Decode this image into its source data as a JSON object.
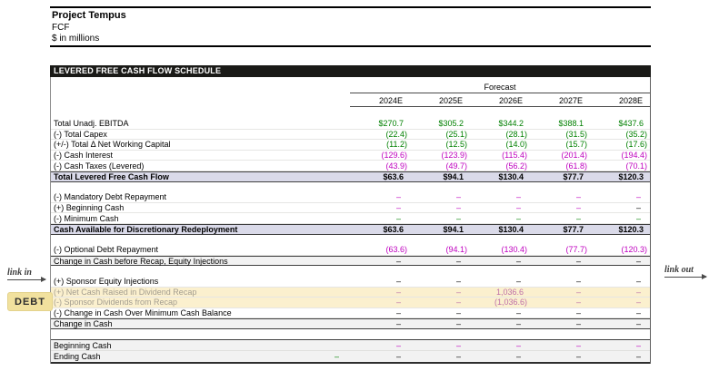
{
  "page_header": {
    "title": "Project Tempus",
    "subtitle": "FCF",
    "units": "$ in millions"
  },
  "section_bar": {
    "title": "LEVERED FREE CASH FLOW SCHEDULE"
  },
  "annotations": {
    "link_in": "link in",
    "link_out": "link out",
    "debt_button": "DEBT"
  },
  "colors": {
    "green": "#008000",
    "magenta": "#bf00bf",
    "black": "#000000",
    "mauve": "#be6fa8",
    "gray_label": "#a39d8f",
    "lavender_bg": "#dadae9",
    "yellow_bg": "#fbf0ce",
    "gray_bg": "#f2f2f2",
    "debt_button_bg": "#f1e19e",
    "section_bar_bg": "#1a1a17"
  },
  "table": {
    "header": {
      "group_label": "Forecast",
      "columns": [
        "2024E",
        "2025E",
        "2026E",
        "2027E",
        "2028E"
      ]
    },
    "rows": [
      {
        "label": "Total Unadj. EBITDA",
        "values": [
          "$270.7",
          "$305.2",
          "$344.2",
          "$388.1",
          "$437.6"
        ],
        "value_colors": [
          "green",
          "green",
          "green",
          "green",
          "green"
        ],
        "style": "normal"
      },
      {
        "label": "(-) Total Capex",
        "values": [
          "(22.4)",
          "(25.1)",
          "(28.1)",
          "(31.5)",
          "(35.2)"
        ],
        "value_colors": [
          "green",
          "green",
          "green",
          "green",
          "green"
        ],
        "style": "normal"
      },
      {
        "label": "(+/-) Total Δ Net Working Capital",
        "values": [
          "(11.2)",
          "(12.5)",
          "(14.0)",
          "(15.7)",
          "(17.6)"
        ],
        "value_colors": [
          "green",
          "green",
          "green",
          "green",
          "green"
        ],
        "style": "normal"
      },
      {
        "label": "(-) Cash Interest",
        "values": [
          "(129.6)",
          "(123.9)",
          "(115.4)",
          "(201.4)",
          "(194.4)"
        ],
        "value_colors": [
          "magenta",
          "magenta",
          "magenta",
          "magenta",
          "magenta"
        ],
        "style": "normal"
      },
      {
        "label": "(-) Cash Taxes (Levered)",
        "values": [
          "(43.9)",
          "(49.7)",
          "(56.2)",
          "(61.8)",
          "(70.1)"
        ],
        "value_colors": [
          "magenta",
          "magenta",
          "magenta",
          "magenta",
          "magenta"
        ],
        "style": "normal"
      },
      {
        "label": "Total Levered Free Cash Flow",
        "values": [
          "$63.6",
          "$94.1",
          "$130.4",
          "$77.7",
          "$120.3"
        ],
        "value_colors": [
          "black",
          "black",
          "black",
          "black",
          "black"
        ],
        "style": "total"
      },
      {
        "type": "spacer"
      },
      {
        "label": "(-) Mandatory Debt Repayment",
        "values": [
          "–",
          "–",
          "–",
          "–",
          "–"
        ],
        "value_colors": [
          "magenta",
          "magenta",
          "magenta",
          "magenta",
          "magenta"
        ],
        "style": "normal"
      },
      {
        "label": "(+) Beginning Cash",
        "values": [
          "–",
          "–",
          "–",
          "–",
          "–"
        ],
        "value_colors": [
          "magenta",
          "magenta",
          "magenta",
          "magenta",
          "black"
        ],
        "style": "normal"
      },
      {
        "label": "(-) Minimum Cash",
        "values": [
          "–",
          "–",
          "–",
          "–",
          "–"
        ],
        "value_colors": [
          "green",
          "green",
          "green",
          "green",
          "green"
        ],
        "style": "normal"
      },
      {
        "label": "Cash Available for Discretionary Redeployment",
        "values": [
          "$63.6",
          "$94.1",
          "$130.4",
          "$77.7",
          "$120.3"
        ],
        "value_colors": [
          "black",
          "black",
          "black",
          "black",
          "black"
        ],
        "style": "total"
      },
      {
        "type": "spacer"
      },
      {
        "label": "(-) Optional Debt Repayment",
        "values": [
          "(63.6)",
          "(94.1)",
          "(130.4)",
          "(77.7)",
          "(120.3)"
        ],
        "value_colors": [
          "magenta",
          "magenta",
          "magenta",
          "magenta",
          "magenta"
        ],
        "style": "normal"
      },
      {
        "label": "Change in Cash before Recap, Equity Injections",
        "values": [
          "–",
          "–",
          "–",
          "–",
          "–"
        ],
        "value_colors": [
          "black",
          "black",
          "black",
          "black",
          "black"
        ],
        "style": "summary"
      },
      {
        "type": "spacer"
      },
      {
        "label": "(+) Sponsor Equity Injections",
        "values": [
          "–",
          "–",
          "–",
          "–",
          "–"
        ],
        "value_colors": [
          "black",
          "black",
          "black",
          "black",
          "black"
        ],
        "style": "normal"
      },
      {
        "label": "(+) Net Cash Raised in Dividend Recap",
        "values": [
          "–",
          "–",
          "1,036.6",
          "–",
          "–"
        ],
        "value_colors": [
          "mauve",
          "mauve",
          "mauve",
          "mauve",
          "mauve"
        ],
        "style": "yellow"
      },
      {
        "label": "(-) Sponsor Dividends from Recap",
        "values": [
          "–",
          "–",
          "(1,036.6)",
          "–",
          "–"
        ],
        "value_colors": [
          "mauve",
          "mauve",
          "mauve",
          "mauve",
          "mauve"
        ],
        "style": "yellow"
      },
      {
        "label": "(-) Change in Cash Over Minimum Cash Balance",
        "values": [
          "–",
          "–",
          "–",
          "–",
          "–"
        ],
        "value_colors": [
          "black",
          "black",
          "black",
          "black",
          "black"
        ],
        "style": "normal"
      },
      {
        "label": "Change in Cash",
        "values": [
          "–",
          "–",
          "–",
          "–",
          "–"
        ],
        "value_colors": [
          "black",
          "black",
          "black",
          "black",
          "black"
        ],
        "style": "summary"
      },
      {
        "type": "spacer"
      }
    ],
    "bottom_rows": [
      {
        "label": "Beginning Cash",
        "values": [
          "–",
          "–",
          "–",
          "–",
          "–"
        ],
        "value_colors": [
          "magenta",
          "magenta",
          "magenta",
          "magenta",
          "magenta"
        ],
        "style": "normal"
      },
      {
        "label": "Ending Cash",
        "values": [
          "–",
          "–",
          "–",
          "–",
          "–"
        ],
        "value_colors": [
          "black",
          "black",
          "black",
          "black",
          "black"
        ],
        "style": "normal",
        "check_value": "–",
        "check_color": "green"
      }
    ]
  }
}
